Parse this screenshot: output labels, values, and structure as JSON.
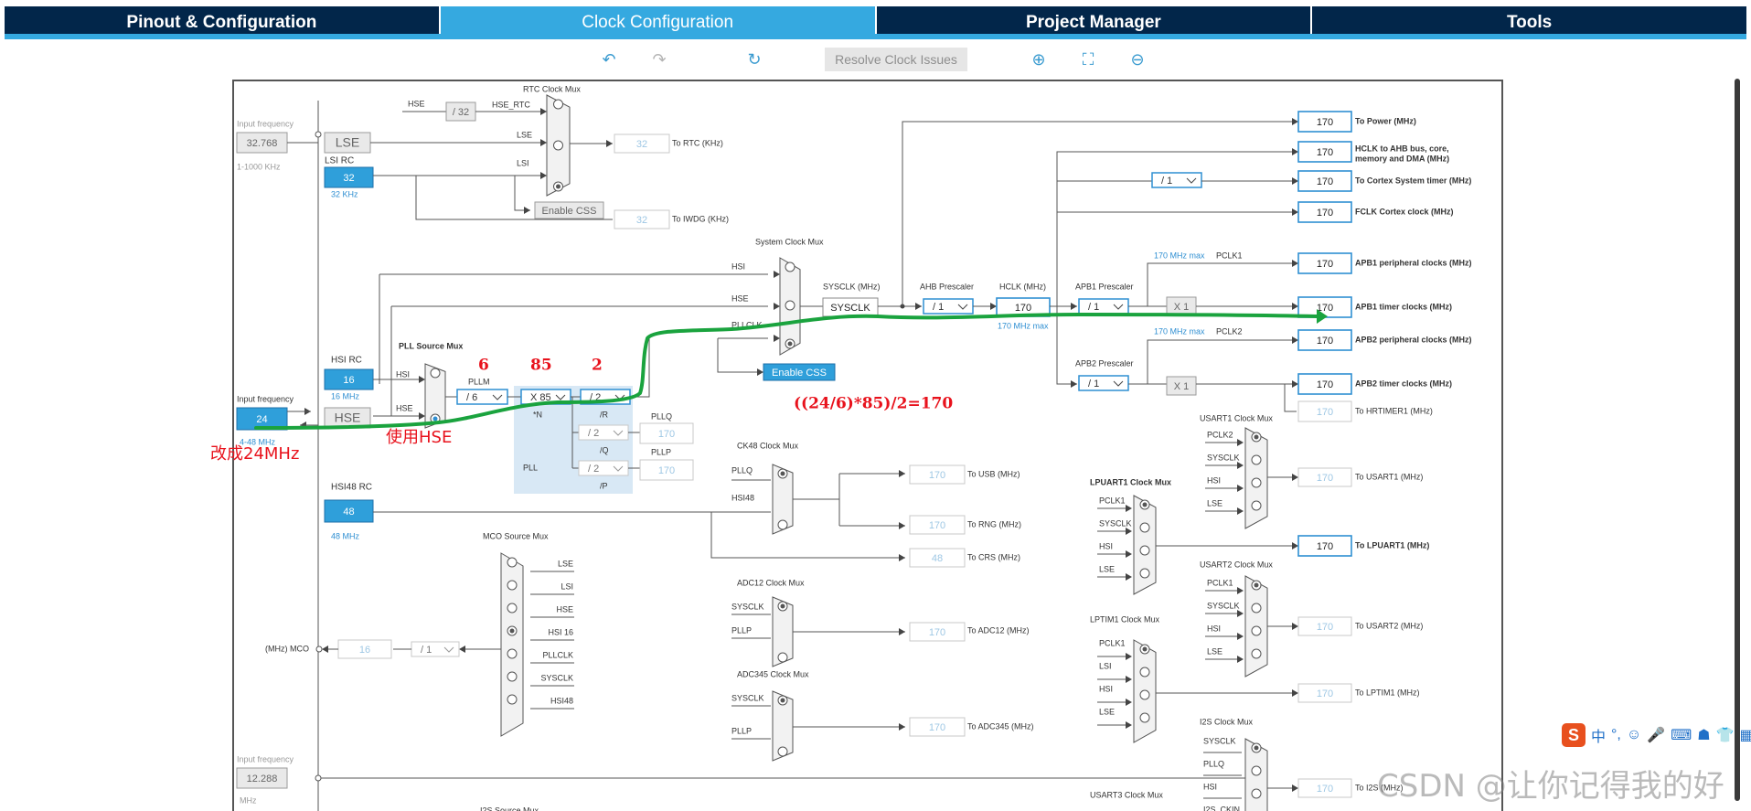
{
  "tabs": [
    "Pinout & Configuration",
    "Clock Configuration",
    "Project Manager",
    "Tools"
  ],
  "toolbar": {
    "undo_icon": "undo-icon",
    "redo_icon": "redo-icon",
    "refresh_icon": "refresh-icon",
    "resolve": "Resolve Clock Issues",
    "zoom_in_icon": "zoom-in-icon",
    "fit_icon": "fit-icon",
    "zoom_out_icon": "zoom-out-icon"
  },
  "colors": {
    "nav": "#02264a",
    "accent": "#35a9e0",
    "path": "#1aa33e",
    "note": "#e8121c"
  },
  "labels": {
    "input_freq": "Input frequency",
    "lse_freq": "32.768",
    "lse_range": "1-1000 KHz",
    "lse": "LSE",
    "lsi_rc": "LSI RC",
    "lsi_val": "32",
    "lsi_khz": "32 KHz",
    "rtc_mux": "RTC Clock Mux",
    "hse": "HSE",
    "div32": "/ 32",
    "hse_rtc": "HSE_RTC",
    "lsi": "LSI",
    "rtc_val": "32",
    "to_rtc": "To RTC (KHz)",
    "enable_css": "Enable CSS",
    "iwdg_val": "32",
    "to_iwdg": "To IWDG (KHz)",
    "sys_mux": "System Clock Mux",
    "hsi": "HSI",
    "pllclk": "PLLCLK",
    "sysclk_label": "SYSCLK (MHz)",
    "sysclk": "SYSCLK",
    "ahb_label": "AHB Prescaler",
    "ahb": "/ 1",
    "hclk_label": "HCLK (MHz)",
    "hclk": "170",
    "hclk_max": "170 MHz max",
    "apb1_label": "APB1 Prescaler",
    "apb1": "/ 1",
    "x1": "X 1",
    "apb2_label": "APB2 Prescaler",
    "apb2": "/ 1",
    "x1b": "X 1",
    "pclk1": "PCLK1",
    "pclk2": "PCLK2",
    "max170a": "170 MHz max",
    "max170b": "170 MHz max",
    "cortex_div": "/ 1",
    "hsi_rc": "HSI RC",
    "hsi_val": "16",
    "hsi_mhz": "16 MHz",
    "pll_src_mux": "PLL Source Mux",
    "input_freq2": "Input frequency",
    "hse_val": "24",
    "hse_range": "4-48 MHz",
    "pllm_label": "PLLM",
    "pllm": "/ 6",
    "n_val": "X 85",
    "n_label": "*N",
    "r_val": "/ 2",
    "r_label": "/R",
    "q_val": "/ 2",
    "q_label": "/Q",
    "p_val": "/ 2",
    "p_label": "/P",
    "pll": "PLL",
    "pllq": "PLLQ",
    "pllq_val": "170",
    "pllp": "PLLP",
    "pllp_val": "170",
    "hsi48_rc": "HSI48 RC",
    "hsi48_val": "48",
    "hsi48_mhz": "48 MHz",
    "ck48_mux": "CK48 Clock Mux",
    "hsi48": "HSI48",
    "usb_val": "170",
    "to_usb": "To USB (MHz)",
    "rng_val": "170",
    "to_rng": "To RNG (MHz)",
    "crs_val": "48",
    "to_crs": "To CRS (MHz)",
    "mco_mux": "MCO Source Mux",
    "mco_lbl": "(MHz) MCO",
    "mco_val": "16",
    "mco_div": "/ 1",
    "hsi16": "HSI 16",
    "adc12_mux": "ADC12 Clock Mux",
    "adc12_val": "170",
    "to_adc12": "To ADC12 (MHz)",
    "adc345_mux": "ADC345 Clock Mux",
    "adc345_val": "170",
    "to_adc345": "To ADC345 (MHz)",
    "ext_freq": "12.288",
    "mhz": "MHz",
    "i2s_src": "I2S Source Mux",
    "lpuart_mux": "LPUART1 Clock Mux",
    "to_lpuart": "To LPUART1 (MHz)",
    "lpuart_val": "170",
    "lptim_mux": "LPTIM1 Clock Mux",
    "to_lptim": "To LPTIM1 (MHz)",
    "lptim_val": "170",
    "usart1_mux": "USART1 Clock Mux",
    "to_usart1": "To USART1 (MHz)",
    "usart1_val": "170",
    "usart2_mux": "USART2 Clock Mux",
    "to_usart2": "To USART2 (MHz)",
    "usart2_val": "170",
    "usart3_mux": "USART3 Clock Mux",
    "i2s_mux": "I2S Clock Mux",
    "to_i2s": "To I2S (MHz)",
    "i2s_val": "170",
    "i2s_ckin": "I2S_CKIN",
    "hrtim_val": "170",
    "to_hrtim": "To HRTIMER1 (MHz)"
  },
  "outputs": [
    {
      "value": "170",
      "label": "To Power (MHz)"
    },
    {
      "value": "170",
      "label": "HCLK to AHB bus, core,"
    },
    {
      "value": "170",
      "label": "To Cortex System timer (MHz)"
    },
    {
      "value": "170",
      "label": "FCLK Cortex clock (MHz)"
    },
    {
      "value": "170",
      "label": "APB1 peripheral clocks (MHz)"
    },
    {
      "value": "170",
      "label": "APB1 timer clocks (MHz)"
    },
    {
      "value": "170",
      "label": "APB2 peripheral clocks (MHz)"
    },
    {
      "value": "170",
      "label": "APB2 timer clocks (MHz)"
    }
  ],
  "hclk_sub": "memory and DMA (MHz)",
  "annotations": {
    "hse_note": "改成24MHz",
    "src_note": "使用HSE",
    "m_note": "6",
    "n_note": "85",
    "r_note": "2",
    "formula": "((24/6)*85)/2=170"
  },
  "ime": [
    "中",
    "°,"
  ],
  "watermark": "CSDN @让你记得我的好"
}
